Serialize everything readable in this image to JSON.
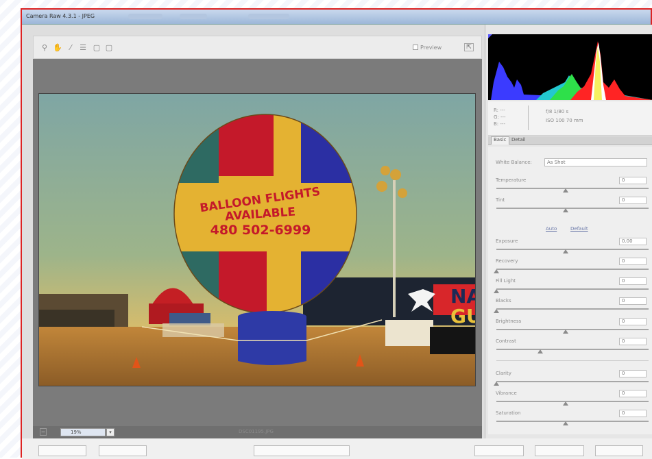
{
  "window": {
    "title": "Camera Raw 4.3.1 - JPEG"
  },
  "toolbar": {
    "tools": [
      "zoom-icon",
      "hand-icon",
      "white-balance-icon",
      "color-sampler-icon",
      "rotate-left-icon",
      "rotate-right-icon"
    ],
    "preview_label": "Preview",
    "fullscreen_label": "⇱"
  },
  "photo": {
    "sign_line1": "BALLOON FLIGHTS",
    "sign_line2": "AVAILABLE",
    "sign_line3": "480 502-6999",
    "banner_text_1": "NA",
    "banner_text_2": "GU"
  },
  "statusbar": {
    "zoom": "19%",
    "filename": "DSC01195.JPG"
  },
  "readout": {
    "r": "R:  ---",
    "g": "G:  ---",
    "b": "B:  ---",
    "exif_line1": "f/8   1/80 s",
    "exif_line2": "ISO 100   70 mm"
  },
  "tabs": {
    "basic": "Basic",
    "detail": "Detail"
  },
  "basic": {
    "white_balance_label": "White Balance:",
    "white_balance_value": "As Shot",
    "auto_link": "Auto",
    "default_link": "Default",
    "controls": [
      {
        "label": "Temperature",
        "value": "0"
      },
      {
        "label": "Tint",
        "value": "0"
      },
      {
        "label": "Exposure",
        "value": "0.00"
      },
      {
        "label": "Recovery",
        "value": "0"
      },
      {
        "label": "Fill Light",
        "value": "0"
      },
      {
        "label": "Blacks",
        "value": "0"
      },
      {
        "label": "Brightness",
        "value": "0"
      },
      {
        "label": "Contrast",
        "value": "0"
      },
      {
        "label": "Clarity",
        "value": "0"
      },
      {
        "label": "Vibrance",
        "value": "0"
      },
      {
        "label": "Saturation",
        "value": "0"
      }
    ]
  },
  "colors": {
    "window_border": "#dd2222",
    "title_bar": "#9db7d8",
    "canvas_bg": "#7b7b7b",
    "histogram_bg": "#000000"
  }
}
